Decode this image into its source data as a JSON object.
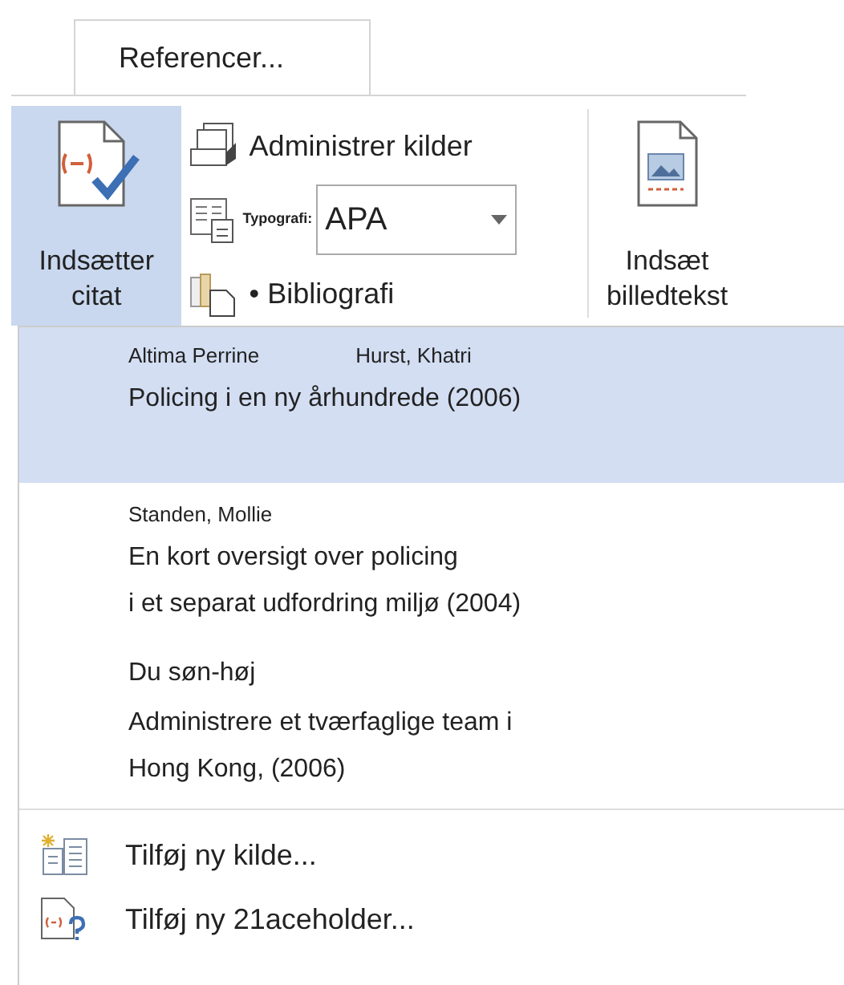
{
  "tab": {
    "label": "Referencer...",
    "selected": true
  },
  "ribbon": {
    "insert_citation": {
      "lines": [
        "Indsætter",
        "citat"
      ],
      "selected": true
    },
    "manage_sources": "Administrer kilder",
    "style": {
      "label": "Typografi:",
      "value": "APA"
    },
    "bibliography": "• Bibliografi",
    "insert_caption": {
      "lines": [
        "Indsæt",
        "billedtekst"
      ]
    }
  },
  "citations": [
    {
      "kind": "small_author",
      "selected": true,
      "authors": [
        "Altima Perrine",
        "Hurst, Khatri"
      ],
      "title_lines": [
        "Policing i en ny århundrede (2006)"
      ]
    },
    {
      "kind": "small_author",
      "selected": false,
      "authors": [
        "Standen, Mollie"
      ],
      "title_lines": [
        "En kort oversigt over policing",
        "i et separat udfordring miljø (2004)"
      ]
    },
    {
      "kind": "large_author",
      "selected": false,
      "authors": [
        "Du søn-høj"
      ],
      "title_lines": [
        "Administrere et tværfaglige team i",
        "Hong Kong, (2006)"
      ]
    }
  ],
  "actions": [
    {
      "kind": "source",
      "label": "Tilføj ny kilde..."
    },
    {
      "kind": "placeholder",
      "label": "Tilføj ny 21aceholder..."
    }
  ]
}
